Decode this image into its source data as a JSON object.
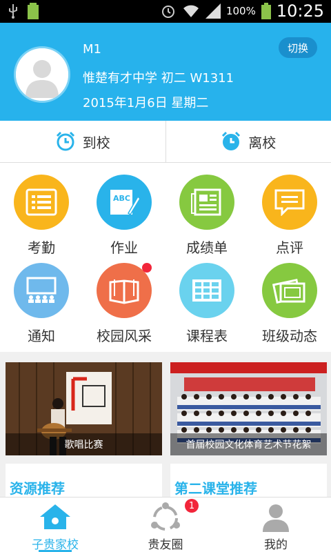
{
  "status_bar": {
    "battery_pct": "100%",
    "time": "10:25"
  },
  "header": {
    "name": "M1",
    "school": "惟楚有才中学 初二 W1311",
    "date": "2015年1月6日 星期二",
    "switch_label": "切换"
  },
  "attendance": {
    "arrive_label": "到校",
    "leave_label": "离校"
  },
  "grid": {
    "items": [
      {
        "label": "考勤",
        "color": "#f9b51c"
      },
      {
        "label": "作业",
        "color": "#29b3ea"
      },
      {
        "label": "成绩单",
        "color": "#86c940"
      },
      {
        "label": "点评",
        "color": "#f9b51c"
      },
      {
        "label": "通知",
        "color": "#6fb9ec"
      },
      {
        "label": "校园风采",
        "color": "#ef6f49"
      },
      {
        "label": "课程表",
        "color": "#6ad2ee"
      },
      {
        "label": "班级动态",
        "color": "#86c940"
      }
    ]
  },
  "banners": [
    {
      "caption": "歌唱比赛"
    },
    {
      "caption": "首届校园文化体育艺术节花絮"
    }
  ],
  "cards": [
    {
      "title": "资源推荐"
    },
    {
      "title": "第二课堂推荐"
    }
  ],
  "tabbar": {
    "tabs": [
      {
        "label": "子贵家校"
      },
      {
        "label": "贵友圈",
        "badge": "1"
      },
      {
        "label": "我的"
      }
    ]
  }
}
